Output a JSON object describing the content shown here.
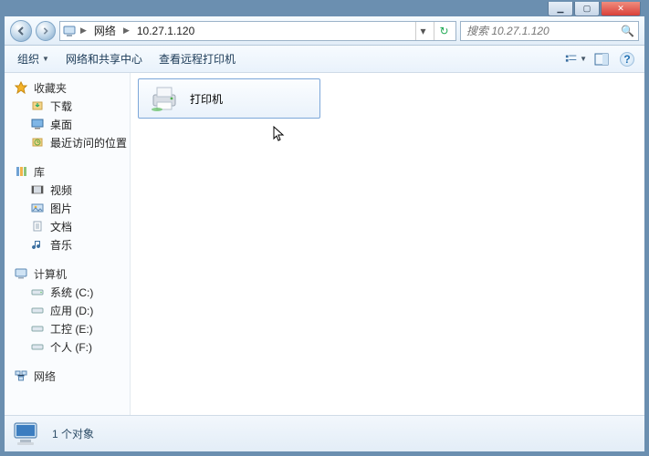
{
  "window_controls": {
    "min": "▁",
    "max": "▢",
    "close": "✕"
  },
  "nav": {
    "crumb_root": "网络",
    "crumb_host": "10.27.1.120",
    "refresh_glyph": "↻",
    "drop_glyph": "▾"
  },
  "search": {
    "placeholder": "搜索 10.27.1.120",
    "icon": "🔍"
  },
  "cmdbar": {
    "organize": "组织",
    "network_center": "网络和共享中心",
    "view_remote_printers": "查看远程打印机"
  },
  "sidebar": {
    "favorites": {
      "label": "收藏夹",
      "items": [
        "下载",
        "桌面",
        "最近访问的位置"
      ]
    },
    "libraries": {
      "label": "库",
      "items": [
        "视频",
        "图片",
        "文档",
        "音乐"
      ]
    },
    "computer": {
      "label": "计算机",
      "items": [
        "系统 (C:)",
        "应用 (D:)",
        "工控 (E:)",
        "个人 (F:)"
      ]
    },
    "network": {
      "label": "网络"
    }
  },
  "content": {
    "tile_label": "打印机"
  },
  "status": {
    "text": "1 个对象"
  }
}
